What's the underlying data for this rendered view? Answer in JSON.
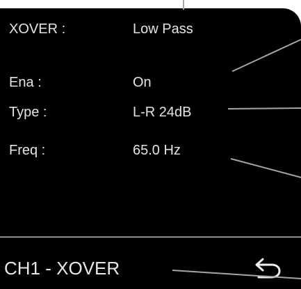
{
  "menu": {
    "header": {
      "label": "XOVER :",
      "value": "Low Pass"
    },
    "rows": [
      {
        "label": "Ena :",
        "value": "On"
      },
      {
        "label": "Type :",
        "value": "L-R 24dB"
      },
      {
        "label": "Freq :",
        "value": "65.0 Hz"
      }
    ]
  },
  "footer": {
    "title": "CH1 - XOVER",
    "back_icon": "back-arrow-icon"
  },
  "colors": {
    "screen": "#000000",
    "text": "#e4e4e4",
    "divider": "#8c8c8c",
    "callout_line": "#9a9a9a"
  }
}
